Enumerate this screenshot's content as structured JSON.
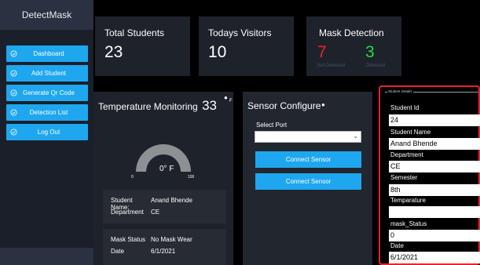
{
  "sidebar": {
    "brand": "DetectMask",
    "items": [
      {
        "label": "Dashboard",
        "icon": "check-circle-icon"
      },
      {
        "label": "Add Student",
        "icon": "check-circle-icon"
      },
      {
        "label": "Generate Qr Code",
        "icon": "check-circle-icon"
      },
      {
        "label": "Detection List",
        "icon": "check-circle-icon"
      },
      {
        "label": "Log Out",
        "icon": "check-circle-icon"
      }
    ]
  },
  "stats": {
    "total_students": {
      "title": "Total Students",
      "value": "23"
    },
    "todays_visitors": {
      "title": "Todays Visitors",
      "value": "10"
    },
    "mask_detection": {
      "title": "Mask Detection",
      "not_detected_value": "7",
      "detected_value": "3",
      "not_detected_label": "Not Detected",
      "detected_label": "Detected"
    }
  },
  "temperature": {
    "title": "Temperature Monitoring",
    "current": "33",
    "unit_mark": "F",
    "gauge_value": 0,
    "gauge_min": "0",
    "gauge_max": "100",
    "gauge_reading": "0° F",
    "student_name_label": "Student Name:",
    "student_name": "Anand Bhende",
    "department_label": "Department",
    "department": "CE",
    "mask_status_label": "Mask Status",
    "mask_status": "No Mask Wear",
    "date_label": "Date",
    "date": "6/1/2021"
  },
  "sensor": {
    "title": "Sensor Configure",
    "select_port_label": "Select Port",
    "port_value": "",
    "connect_button_1": "Connect Sensor",
    "connect_button_2": "Connect Sensor"
  },
  "student_details": {
    "legend": "Student Details",
    "fields": [
      {
        "label": "Student Id",
        "value": "24"
      },
      {
        "label": "Student Name",
        "value": "Anand Bhende"
      },
      {
        "label": "Department",
        "value": "CE"
      },
      {
        "label": "Semester",
        "value": "8th"
      },
      {
        "label": "Temparature",
        "value": ""
      },
      {
        "label": "mask_Status",
        "value": "0"
      },
      {
        "label": "Date",
        "value": "6/1/2021"
      }
    ]
  },
  "colors": {
    "accent": "#1ea7ef",
    "not_detected": "#ee2222",
    "detected": "#22dd44",
    "details_border": "#e8242f"
  }
}
